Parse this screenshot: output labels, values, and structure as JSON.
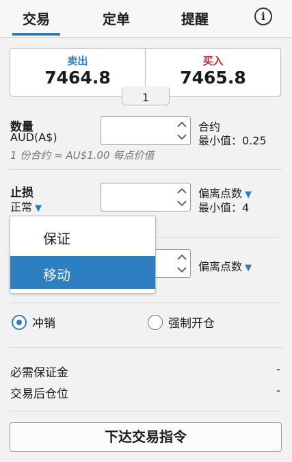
{
  "tabs": [
    {
      "label": "交易",
      "active": true
    },
    {
      "label": "定单",
      "active": false
    },
    {
      "label": "提醒",
      "active": false
    }
  ],
  "info_icon": "info-icon",
  "quote": {
    "sell_label": "卖出",
    "sell_price": "7464.8",
    "buy_label": "买入",
    "buy_price": "7465.8",
    "spread": "1"
  },
  "quantity": {
    "label": "数量",
    "currency": "AUD(A$)",
    "value": "",
    "unit": "合约",
    "min": "最小值：0.25",
    "note": "1 份合约 = AU$1.00 每点价值"
  },
  "stop": {
    "label": "止损",
    "mode": "正常",
    "value": "",
    "unit": "偏离点数",
    "min": "最小值：4"
  },
  "limit_row": {
    "unit": "偏离点数"
  },
  "stop_type_dropdown": {
    "options": [
      "保证",
      "移动"
    ],
    "selected_index": 1
  },
  "position_mode": {
    "options": [
      {
        "label": "冲销",
        "checked": true
      },
      {
        "label": "强制开仓",
        "checked": false
      }
    ]
  },
  "summary": {
    "margin_label": "必需保证金",
    "margin_value": "-",
    "position_label": "交易后仓位",
    "position_value": "-"
  },
  "submit_label": "下达交易指令",
  "colors": {
    "accent": "#2d7bbf",
    "sell": "#2c7fc0",
    "buy": "#c0262c",
    "selected_option_bg": "#2e7fc1"
  }
}
